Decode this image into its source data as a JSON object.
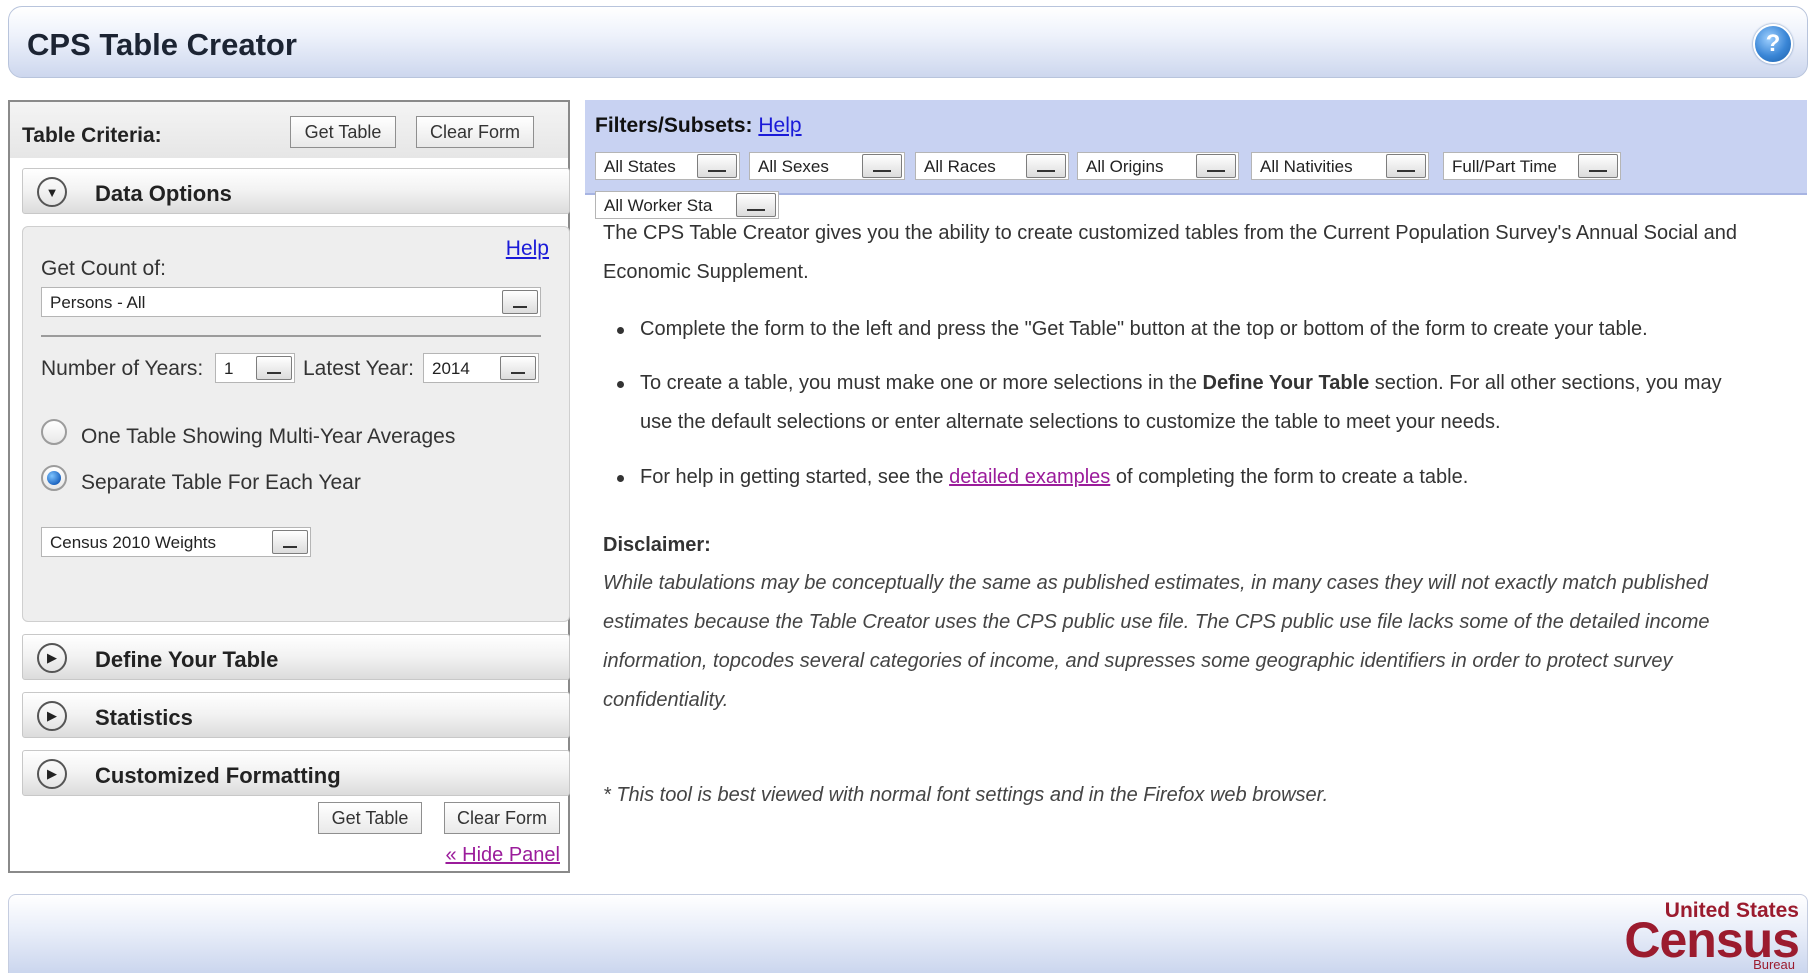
{
  "header": {
    "title": "CPS Table Creator",
    "help_icon_glyph": "?"
  },
  "left_panel": {
    "criteria_label": "Table Criteria:",
    "get_table": "Get Table",
    "clear_form": "Clear Form",
    "sections": {
      "data_options": "Data Options",
      "define_your_table": "Define Your Table",
      "statistics": "Statistics",
      "customized_formatting": "Customized Formatting"
    },
    "data_options": {
      "help": "Help",
      "get_count_label": "Get Count of:",
      "get_count_value": "Persons - All",
      "number_of_years_label": "Number of Years:",
      "number_of_years_value": "1",
      "latest_year_label": "Latest Year:",
      "latest_year_value": "2014",
      "radio_multi_year": "One Table Showing Multi-Year Averages",
      "radio_separate": "Separate Table For Each Year",
      "weights_value": "Census 2010 Weights"
    },
    "hide_panel": "« Hide Panel"
  },
  "filters": {
    "label": "Filters/Subsets:",
    "help": "Help",
    "items": [
      "All States",
      "All Sexes",
      "All Races",
      "All Origins",
      "All Nativities",
      "Full/Part Time",
      "All Worker Sta"
    ]
  },
  "content": {
    "intro_line1": "The CPS Table Creator gives you the ability to create customized tables from the Current Population Survey's Annual Social and",
    "intro_line2": "Economic Supplement.",
    "bullet1": "Complete the form to the left and press the \"Get Table\" button at the top or bottom of the form to create your table.",
    "bullet2_pre": "To create a table, you must make one or more selections in the ",
    "bullet2_bold": "Define Your Table",
    "bullet2_post": " section. For all other sections, you may",
    "bullet2_line2": "use the default selections or enter alternate selections to customize the table to meet your needs.",
    "bullet3_pre": "For help in getting started, see the ",
    "bullet3_link": "detailed examples",
    "bullet3_post": " of completing the form to create a table.",
    "disclaimer_title": "Disclaimer:",
    "disclaimer_lines": [
      "While tabulations may be conceptually the same as published estimates, in many cases they will not exactly match published",
      "estimates because the Table Creator uses the CPS public use file. The CPS public use file lacks some of the detailed income",
      "information, topcodes several categories of income, and supresses some geographic identifiers in order to protect survey",
      "confidentiality."
    ],
    "note": "* This tool is best viewed with normal font settings and in the Firefox web browser."
  },
  "footer": {
    "logo_top": "United States",
    "logo_main": "Census",
    "logo_bottom": "Bureau"
  },
  "colors": {
    "header_gradient_end": "#cdd7ee",
    "filters_bar": "#c8d2f2",
    "link_blue": "#1a1ad8",
    "link_visited": "#9b1c9b",
    "census_red": "#9b1b2e"
  }
}
